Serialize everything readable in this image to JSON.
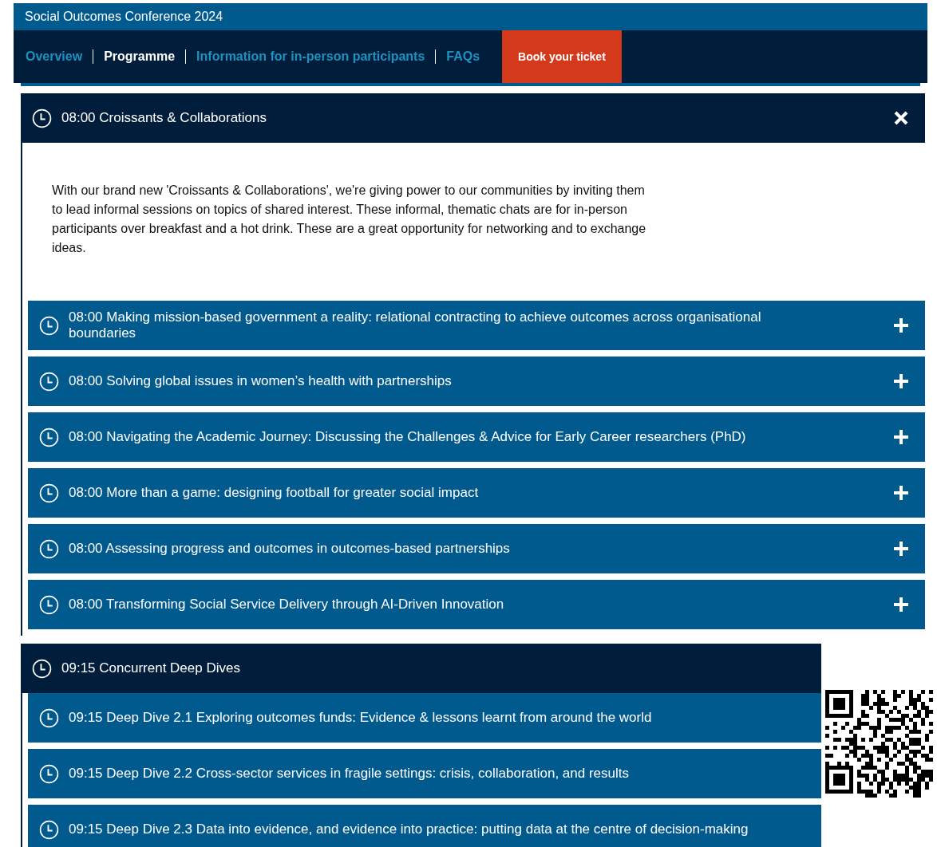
{
  "site": {
    "title": "Social Outcomes Conference 2024"
  },
  "nav": [
    {
      "label": "Overview",
      "selected": false
    },
    {
      "label": "Programme",
      "selected": true
    },
    {
      "label": "Information for in-person participants",
      "selected": false
    },
    {
      "label": "FAQs",
      "selected": false
    }
  ],
  "cta": {
    "label": "Book your ticket"
  },
  "sessions": [
    {
      "time": "08:00",
      "title": "Croissants & Collaborations",
      "expanded": true,
      "description": "With our brand new 'Croissants & Collaborations', we're giving power to our communities by inviting them to lead informal sessions on topics of shared interest. These informal, thematic chats are for in-person participants over breakfast and a hot drink. These are a great opportunity for networking and to exchange ideas.",
      "children": [
        {
          "time": "08:00",
          "title": "Making mission-based government a reality: relational contracting to achieve outcomes across organisational boundaries",
          "expanded": false
        },
        {
          "time": "08:00",
          "title": "Solving global issues in women’s health with partnerships",
          "expanded": false
        },
        {
          "time": "08:00",
          "title": "Navigating the Academic Journey: Discussing the Challenges & Advice for Early Career researchers (PhD)",
          "expanded": false
        },
        {
          "time": "08:00",
          "title": "More than a game: designing football for greater social impact",
          "expanded": false
        },
        {
          "time": "08:00",
          "title": "Assessing progress and outcomes in outcomes-based partnerships",
          "expanded": false
        },
        {
          "time": "08:00",
          "title": "Transforming Social Service Delivery through AI-Driven Innovation",
          "expanded": false
        }
      ]
    },
    {
      "time": "09:15",
      "title": "Concurrent Deep Dives",
      "children": [
        {
          "time": "09:15",
          "title": "Deep Dive 2.1 Exploring outcomes funds: Evidence & lessons learnt from around the world"
        },
        {
          "time": "09:15",
          "title": "Deep Dive 2.2 Cross-sector services in fragile settings: crisis, collaboration, and results"
        },
        {
          "time": "09:15",
          "title": "Deep Dive 2.3 Data into evidence, and evidence into practice: putting data at the centre of decision-making"
        }
      ]
    }
  ]
}
